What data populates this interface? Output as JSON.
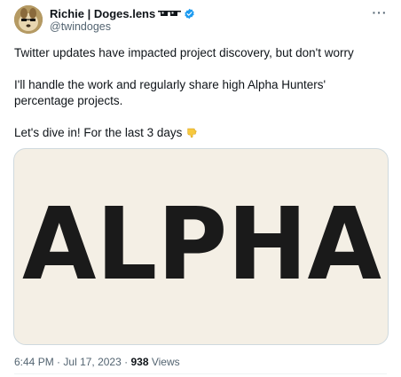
{
  "author": {
    "display_name": "Richie | Doges.lens",
    "handle": "@twindoges",
    "verified": true,
    "avatar_icon": "avatar-image",
    "name_emoji": "pixel-glasses-icon"
  },
  "tweet": {
    "paragraphs": [
      "Twitter updates have impacted project discovery, but don't worry",
      "I'll handle the work and regularly share high Alpha Hunters' percentage projects.",
      "Let's dive in! For the last 3 days"
    ],
    "emoji": "backhand-index-pointing-down",
    "media_word": "ALPHA"
  },
  "meta": {
    "time": "6:44 PM",
    "separator": "·",
    "date": "Jul 17, 2023",
    "views_count": "938",
    "views_label": "Views"
  },
  "colors": {
    "verified_badge": "#1d9bf0",
    "muted_text": "#536471",
    "media_background": "#f4efe5",
    "media_text": "#1a1a1a"
  }
}
